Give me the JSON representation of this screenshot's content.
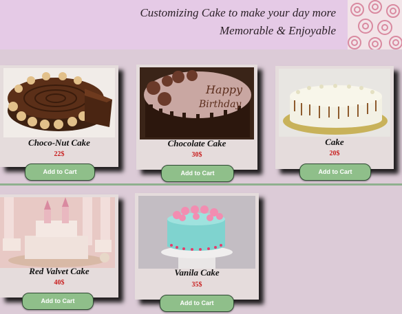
{
  "header": {
    "tagline_line1": "Customizing Cake to make your day more",
    "tagline_line2": "Memorable & Enjoyable"
  },
  "products": [
    {
      "name": "Choco-Nut Cake",
      "price": "22$",
      "button": "Add to Cart"
    },
    {
      "name": "Chocolate Cake",
      "price": "30$",
      "button": "Add to Cart"
    },
    {
      "name": "Cake",
      "price": "20$",
      "button": "Add to Cart"
    },
    {
      "name": "Red Valvet Cake",
      "price": "40$",
      "button": "Add to Cart"
    },
    {
      "name": "Vanila Cake",
      "price": "35$",
      "button": "Add to Cart"
    }
  ],
  "colors": {
    "banner": "#e5cae6",
    "page": "#dccbd7",
    "card": "#e5dcdc",
    "button": "#8fbf8a",
    "price": "#c81d1d",
    "divider": "#8fb08e"
  }
}
